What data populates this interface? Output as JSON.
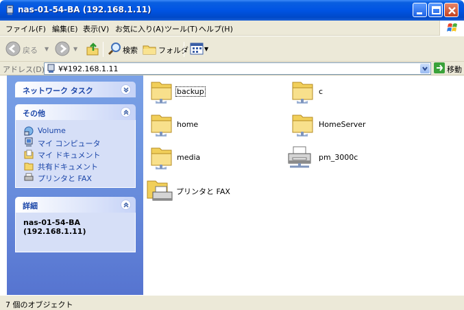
{
  "window": {
    "title": "nas-01-54-BA (192.168.1.11)"
  },
  "menu": [
    "ファイル(F)",
    "編集(E)",
    "表示(V)",
    "お気に入り(A)",
    "ツール(T)",
    "ヘルプ(H)"
  ],
  "toolbar": {
    "back_label": "戻る",
    "search_label": "検索",
    "folders_label": "フォルダ"
  },
  "address": {
    "label": "アドレス(D)",
    "value": "¥¥192.168.1.11",
    "go_label": "移動"
  },
  "sidebar": {
    "network_tasks": {
      "title": "ネットワーク タスク"
    },
    "other": {
      "title": "その他",
      "links": [
        "Volume",
        "マイ コンピュータ",
        "マイ ドキュメント",
        "共有ドキュメント",
        "プリンタと FAX"
      ]
    },
    "details": {
      "title": "詳細",
      "name": "nas-01-54-BA",
      "ip": "(192.168.1.11)"
    }
  },
  "items": [
    {
      "name": "backup",
      "icon": "shared-folder-icon"
    },
    {
      "name": "c",
      "icon": "shared-folder-icon"
    },
    {
      "name": "home",
      "icon": "shared-folder-icon"
    },
    {
      "name": "HomeServer",
      "icon": "shared-folder-icon"
    },
    {
      "name": "media",
      "icon": "shared-folder-icon"
    },
    {
      "name": "pm_3000c",
      "icon": "network-printer-icon"
    },
    {
      "name": "プリンタと FAX",
      "icon": "printers-folder-icon"
    }
  ],
  "status": {
    "text": "7 個のオブジェクト"
  },
  "colors": {
    "titlebar": "#0054e3",
    "sidebar": "#6d93df",
    "link": "#1a45a8"
  }
}
